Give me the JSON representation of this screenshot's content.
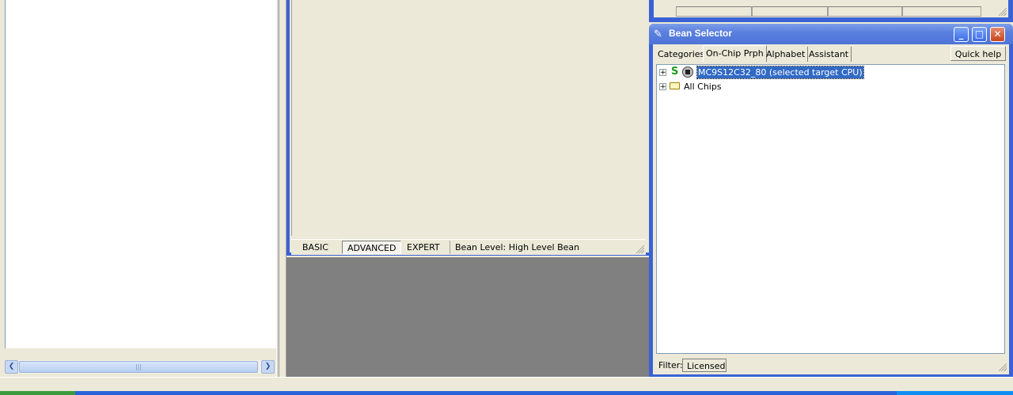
{
  "inspector": {
    "levels": [
      "BASIC",
      "ADVANCED",
      "EXPERT"
    ],
    "active_level": "ADVANCED",
    "status_text": "Bean Level: High Level Bean"
  },
  "bean_selector": {
    "title": "Bean Selector",
    "tabs": [
      "Categories",
      "On-Chip Prph",
      "Alphabet",
      "Assistant"
    ],
    "active_tab": "On-Chip Prph",
    "quick_help": "Quick help >",
    "tree": {
      "items": [
        {
          "label": "MC9S12C32_80 (selected target CPU)",
          "selected": true,
          "icon": "cpu-chip-icon"
        },
        {
          "label": "All Chips",
          "selected": false,
          "icon": "folder-icon"
        }
      ]
    },
    "filter": {
      "label": "Filter:",
      "value": "Licensed"
    }
  },
  "colors": {
    "window_frame": "#3a62d6",
    "selection": "#316ac5",
    "face": "#ece9d8"
  }
}
